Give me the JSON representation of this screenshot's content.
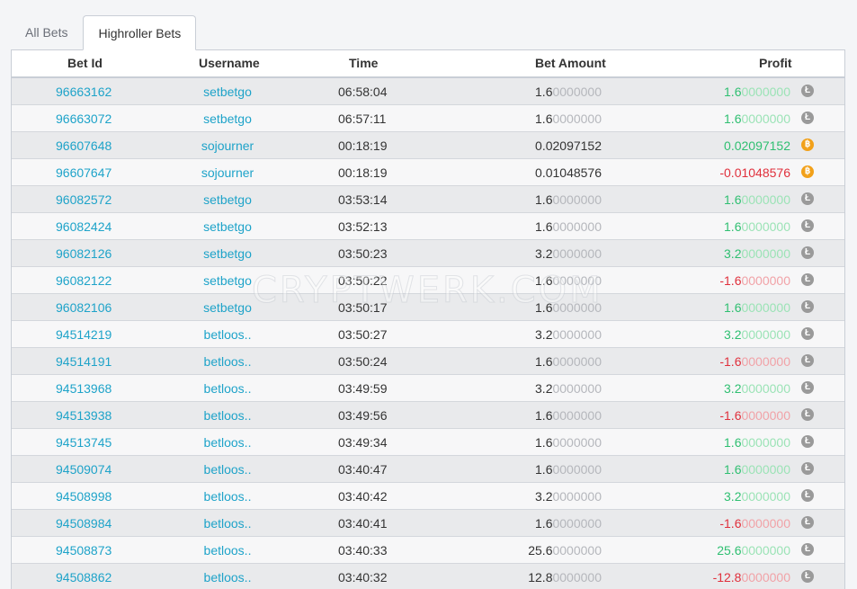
{
  "tabs": [
    {
      "label": "All Bets",
      "active": false
    },
    {
      "label": "Highroller Bets",
      "active": true
    }
  ],
  "table": {
    "headers": {
      "bet_id": "Bet Id",
      "username": "Username",
      "time": "Time",
      "bet_amount": "Bet Amount",
      "profit": "Profit"
    },
    "rows": [
      {
        "bet_id": "96663162",
        "username": "setbetgo",
        "time": "06:58:04",
        "amount_main": "1.6",
        "amount_dim": "0000000",
        "profit_main": "1.6",
        "profit_dim": "0000000",
        "profit_sign": "pos",
        "coin": "litecoin-icon"
      },
      {
        "bet_id": "96663072",
        "username": "setbetgo",
        "time": "06:57:11",
        "amount_main": "1.6",
        "amount_dim": "0000000",
        "profit_main": "1.6",
        "profit_dim": "0000000",
        "profit_sign": "pos",
        "coin": "litecoin-icon"
      },
      {
        "bet_id": "96607648",
        "username": "sojourner",
        "time": "00:18:19",
        "amount_main": "0.02097152",
        "amount_dim": "",
        "profit_main": "0.02097152",
        "profit_dim": "",
        "profit_sign": "pos",
        "coin": "bitcoin-icon"
      },
      {
        "bet_id": "96607647",
        "username": "sojourner",
        "time": "00:18:19",
        "amount_main": "0.01048576",
        "amount_dim": "",
        "profit_main": "-0.01048576",
        "profit_dim": "",
        "profit_sign": "neg",
        "coin": "bitcoin-icon"
      },
      {
        "bet_id": "96082572",
        "username": "setbetgo",
        "time": "03:53:14",
        "amount_main": "1.6",
        "amount_dim": "0000000",
        "profit_main": "1.6",
        "profit_dim": "0000000",
        "profit_sign": "pos",
        "coin": "litecoin-icon"
      },
      {
        "bet_id": "96082424",
        "username": "setbetgo",
        "time": "03:52:13",
        "amount_main": "1.6",
        "amount_dim": "0000000",
        "profit_main": "1.6",
        "profit_dim": "0000000",
        "profit_sign": "pos",
        "coin": "litecoin-icon"
      },
      {
        "bet_id": "96082126",
        "username": "setbetgo",
        "time": "03:50:23",
        "amount_main": "3.2",
        "amount_dim": "0000000",
        "profit_main": "3.2",
        "profit_dim": "0000000",
        "profit_sign": "pos",
        "coin": "litecoin-icon"
      },
      {
        "bet_id": "96082122",
        "username": "setbetgo",
        "time": "03:50:22",
        "amount_main": "1.6",
        "amount_dim": "0000000",
        "profit_main": "-1.6",
        "profit_dim": "0000000",
        "profit_sign": "neg",
        "coin": "litecoin-icon"
      },
      {
        "bet_id": "96082106",
        "username": "setbetgo",
        "time": "03:50:17",
        "amount_main": "1.6",
        "amount_dim": "0000000",
        "profit_main": "1.6",
        "profit_dim": "0000000",
        "profit_sign": "pos",
        "coin": "litecoin-icon"
      },
      {
        "bet_id": "94514219",
        "username": "betloos..",
        "time": "03:50:27",
        "amount_main": "3.2",
        "amount_dim": "0000000",
        "profit_main": "3.2",
        "profit_dim": "0000000",
        "profit_sign": "pos",
        "coin": "litecoin-icon"
      },
      {
        "bet_id": "94514191",
        "username": "betloos..",
        "time": "03:50:24",
        "amount_main": "1.6",
        "amount_dim": "0000000",
        "profit_main": "-1.6",
        "profit_dim": "0000000",
        "profit_sign": "neg",
        "coin": "litecoin-icon"
      },
      {
        "bet_id": "94513968",
        "username": "betloos..",
        "time": "03:49:59",
        "amount_main": "3.2",
        "amount_dim": "0000000",
        "profit_main": "3.2",
        "profit_dim": "0000000",
        "profit_sign": "pos",
        "coin": "litecoin-icon"
      },
      {
        "bet_id": "94513938",
        "username": "betloos..",
        "time": "03:49:56",
        "amount_main": "1.6",
        "amount_dim": "0000000",
        "profit_main": "-1.6",
        "profit_dim": "0000000",
        "profit_sign": "neg",
        "coin": "litecoin-icon"
      },
      {
        "bet_id": "94513745",
        "username": "betloos..",
        "time": "03:49:34",
        "amount_main": "1.6",
        "amount_dim": "0000000",
        "profit_main": "1.6",
        "profit_dim": "0000000",
        "profit_sign": "pos",
        "coin": "litecoin-icon"
      },
      {
        "bet_id": "94509074",
        "username": "betloos..",
        "time": "03:40:47",
        "amount_main": "1.6",
        "amount_dim": "0000000",
        "profit_main": "1.6",
        "profit_dim": "0000000",
        "profit_sign": "pos",
        "coin": "litecoin-icon"
      },
      {
        "bet_id": "94508998",
        "username": "betloos..",
        "time": "03:40:42",
        "amount_main": "3.2",
        "amount_dim": "0000000",
        "profit_main": "3.2",
        "profit_dim": "0000000",
        "profit_sign": "pos",
        "coin": "litecoin-icon"
      },
      {
        "bet_id": "94508984",
        "username": "betloos..",
        "time": "03:40:41",
        "amount_main": "1.6",
        "amount_dim": "0000000",
        "profit_main": "-1.6",
        "profit_dim": "0000000",
        "profit_sign": "neg",
        "coin": "litecoin-icon"
      },
      {
        "bet_id": "94508873",
        "username": "betloos..",
        "time": "03:40:33",
        "amount_main": "25.6",
        "amount_dim": "0000000",
        "profit_main": "25.6",
        "profit_dim": "0000000",
        "profit_sign": "pos",
        "coin": "litecoin-icon"
      },
      {
        "bet_id": "94508862",
        "username": "betloos..",
        "time": "03:40:32",
        "amount_main": "12.8",
        "amount_dim": "0000000",
        "profit_main": "-12.8",
        "profit_dim": "0000000",
        "profit_sign": "neg",
        "coin": "litecoin-icon"
      }
    ]
  },
  "watermark": "CRYPTWERK.COM",
  "colors": {
    "link": "#1ea3c9",
    "positive": "#2fbf71",
    "negative": "#e0303c",
    "btc": "#f2a11a",
    "ltc": "#9a9a9a"
  }
}
